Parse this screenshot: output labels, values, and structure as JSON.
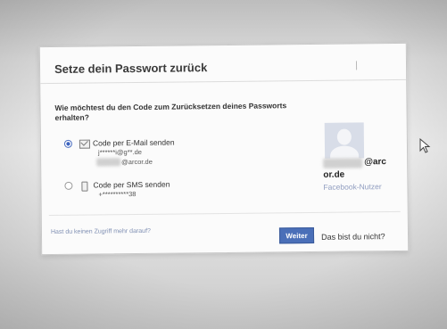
{
  "dialog": {
    "title": "Setze dein Passwort zurück",
    "question": "Wie möchtest du den Code zum Zurücksetzen deines Passworts erhalten?"
  },
  "options": {
    "email": {
      "label": "Code per E-Mail senden",
      "selected": true,
      "line1": "j******i@g**.de",
      "line2": "@arcor.de"
    },
    "sms": {
      "label": "Code per SMS senden",
      "selected": false,
      "line1": "+**********38"
    }
  },
  "profile": {
    "name_suffix": "@arc",
    "name_domain": "or.de",
    "type": "Facebook-Nutzer"
  },
  "footer": {
    "no_access": "Hast du keinen Zugriff mehr darauf?",
    "continue_label": "Weiter",
    "not_you": "Das bist du nicht?"
  },
  "colors": {
    "button_blue": "#4a6fb8",
    "link_blue": "#7f8fb3",
    "radio_selected": "#3b63c0"
  },
  "icons": {
    "mail": "mail-icon",
    "phone": "phone-icon",
    "cursor": "cursor-icon"
  }
}
